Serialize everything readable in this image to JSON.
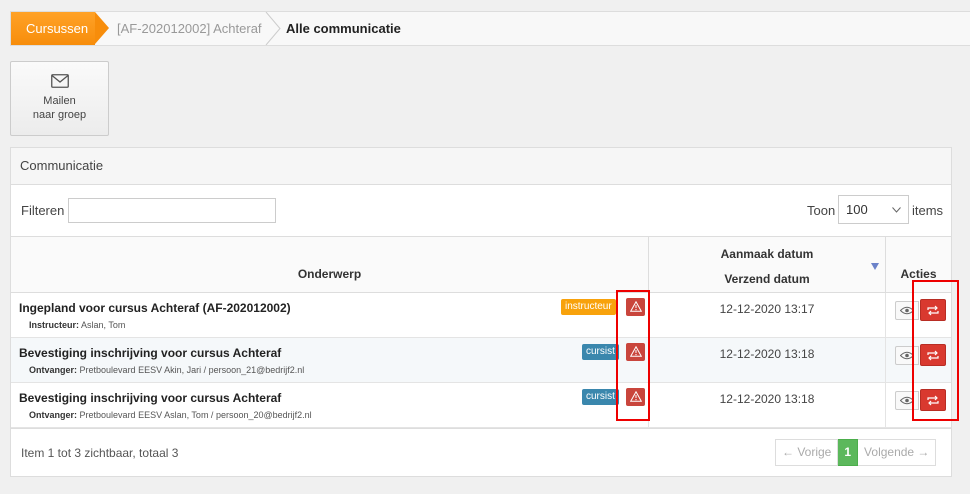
{
  "breadcrumb": {
    "items": [
      {
        "label": "Cursussen"
      },
      {
        "label": "[AF-202012002] Achteraf"
      },
      {
        "label": "Alle communicatie"
      }
    ]
  },
  "toolbar": {
    "mail_group": {
      "label_line1": "Mailen",
      "label_line2": "naar groep",
      "icon": "envelope-icon"
    }
  },
  "panel": {
    "title": "Communicatie",
    "filter": {
      "label": "Filteren",
      "value": "",
      "placeholder": ""
    },
    "page_size": {
      "label_before": "Toon",
      "value": "100",
      "label_after": "items"
    },
    "columns": {
      "subject": "Onderwerp",
      "created": "Aanmaak datum",
      "sent": "Verzend datum",
      "actions": "Acties"
    },
    "rows": [
      {
        "title": "Ingepland voor cursus Achteraf (AF-202012002)",
        "badge": "instructeur",
        "meta_label": "Instructeur:",
        "meta_value": "Aslan, Tom",
        "date": "12-12-2020 13:17"
      },
      {
        "title": "Bevestiging inschrijving voor cursus Achteraf",
        "badge": "cursist",
        "meta_label": "Ontvanger:",
        "meta_value": "Pretboulevard EESV Akin, Jari / persoon_21@bedrijf2.nl",
        "date": "12-12-2020 13:18"
      },
      {
        "title": "Bevestiging inschrijving voor cursus Achteraf",
        "badge": "cursist",
        "meta_label": "Ontvanger:",
        "meta_value": "Pretboulevard EESV Aslan, Tom / persoon_20@bedrijf2.nl",
        "date": "12-12-2020 13:18"
      }
    ],
    "footer": {
      "summary": "Item 1 tot 3 zichtbaar, totaal 3",
      "prev": "← Vorige",
      "current_page": "1",
      "next": "Volgende →"
    }
  },
  "colors": {
    "accent_orange": "#f78d0b",
    "badge_instructeur": "#f8a20c",
    "badge_cursist": "#3a87ad",
    "danger": "#d9392f",
    "pager_active": "#5cb85c"
  }
}
